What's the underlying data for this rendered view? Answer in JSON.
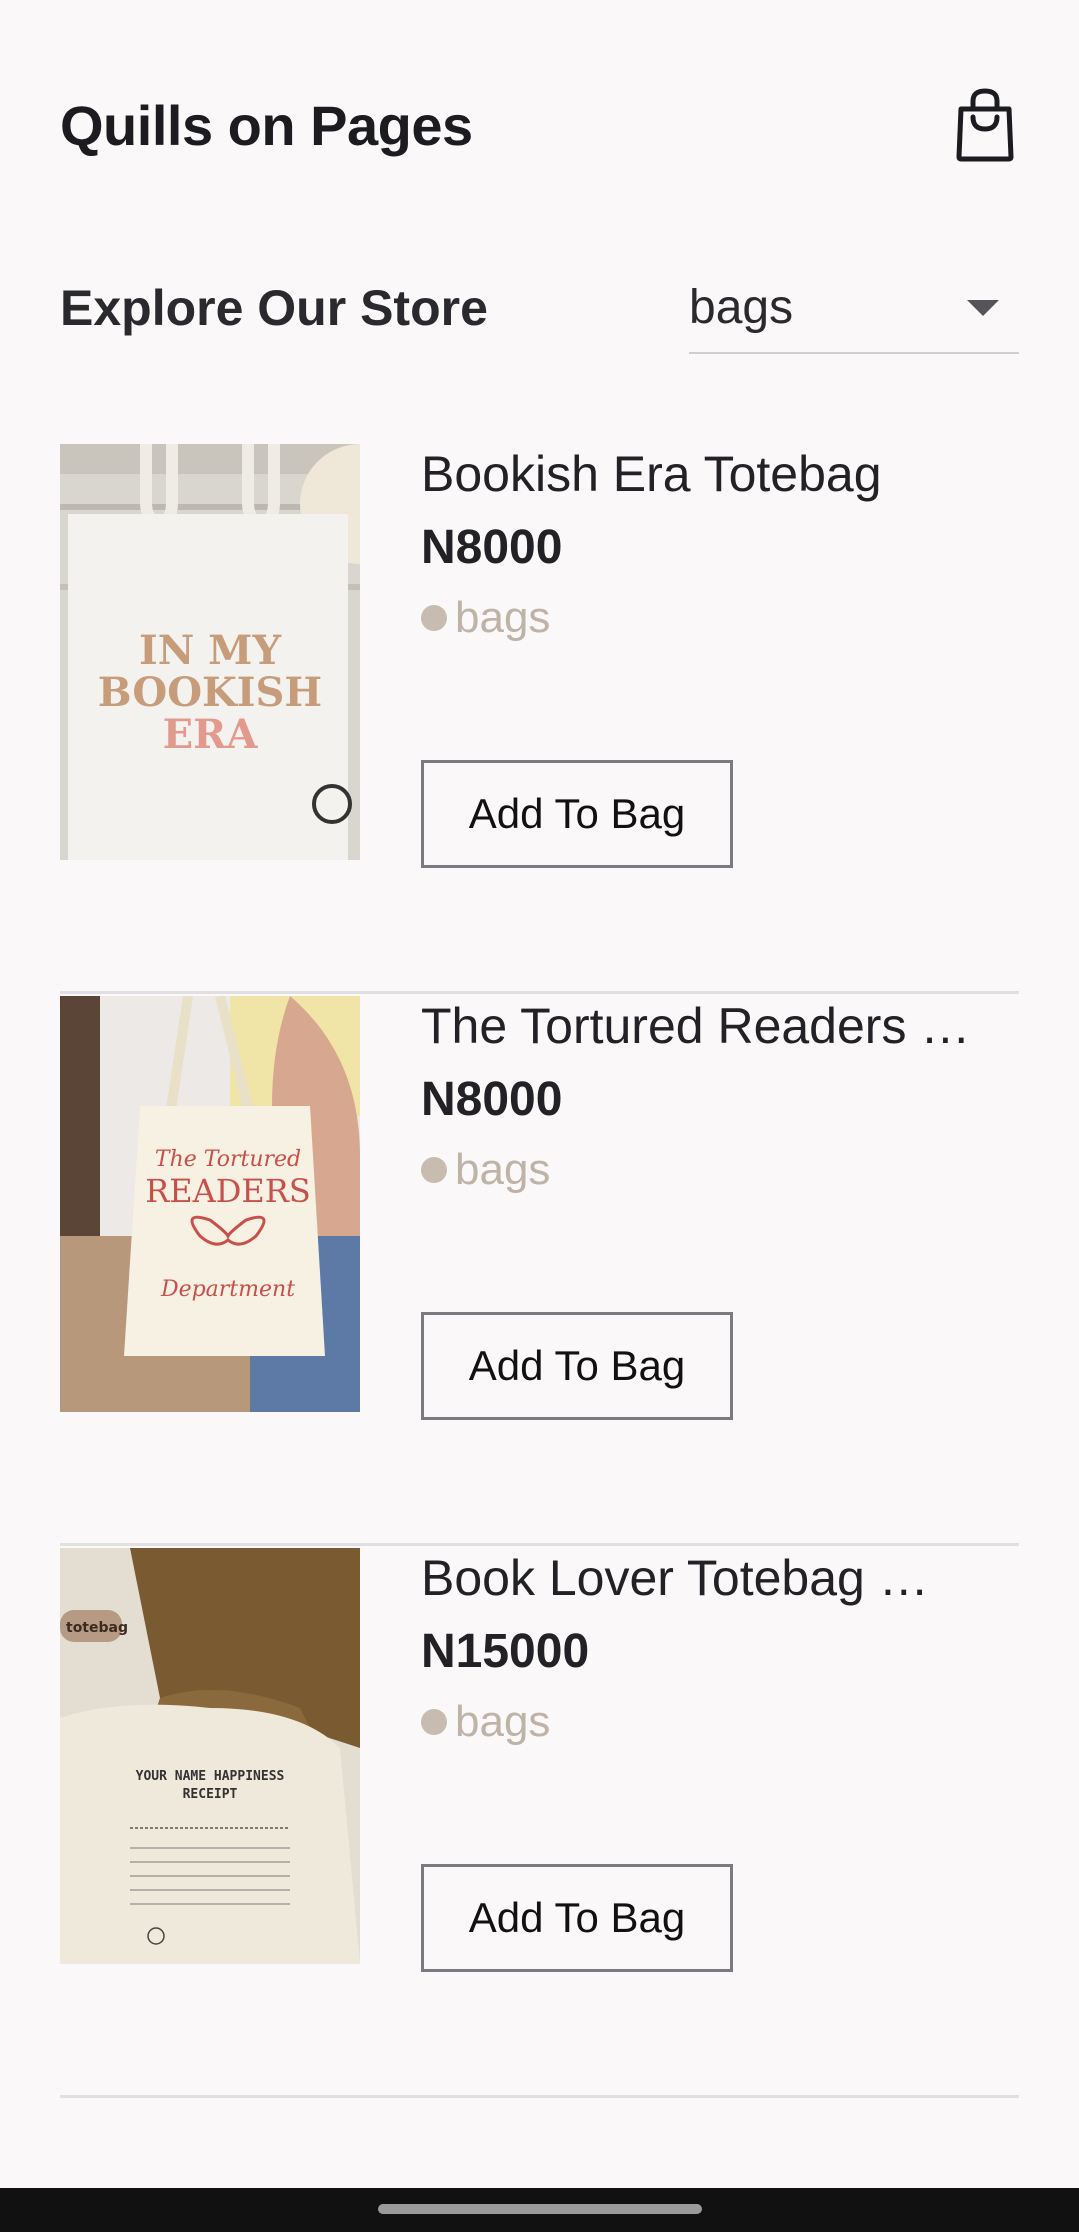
{
  "header": {
    "title": "Quills on Pages",
    "cart_icon": "shopping-bag-icon"
  },
  "explore": {
    "title": "Explore Our Store",
    "filter_value": "bags"
  },
  "products": [
    {
      "name": "Bookish Era Totebag",
      "price": "N8000",
      "category": "bags",
      "button": "Add To Bag",
      "image_text": [
        "IN MY",
        "BOOKISH",
        "ERA"
      ]
    },
    {
      "name": "The Tortured Readers …",
      "price": "N8000",
      "category": "bags",
      "button": "Add To Bag",
      "image_text": [
        "The Tortured",
        "READERS",
        "Department"
      ]
    },
    {
      "name": "Book Lover Totebag …",
      "price": "N15000",
      "category": "bags",
      "button": "Add To Bag",
      "image_text": [
        "totebag",
        "YOUR NAME HAPPINESS",
        "RECEIPT"
      ]
    }
  ],
  "colors": {
    "background": "#faf8f9",
    "category": "#c8bbb0",
    "divider": "#e1dfe2"
  }
}
